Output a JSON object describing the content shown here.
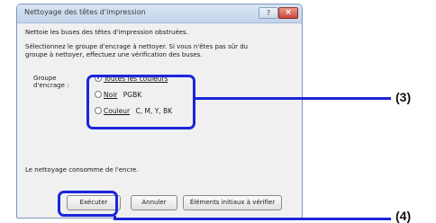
{
  "dialog": {
    "title": "Nettoyage des têtes d'impression",
    "help_symbol": "?",
    "close_symbol": "×",
    "intro": "Nettoie les buses des têtes d'impression obstruées.",
    "instruction_line1": "Sélectionnez le groupe d'encrage à nettoyer. Si vous n'êtes pas sûr du",
    "instruction_line2": "groupe à nettoyer, effectuez une vérification des buses.",
    "group_label_line1": "Groupe",
    "group_label_line2": "d'encrage :",
    "options": [
      {
        "label": "Toutes les couleurs",
        "checked": true
      },
      {
        "label": "Noir",
        "detail": "PGBK",
        "checked": false
      },
      {
        "label": "Couleur",
        "detail": "C, M, Y, BK",
        "checked": false
      }
    ],
    "note": "Le nettoyage consomme de l'encre.",
    "buttons": {
      "run": "Exécuter",
      "cancel": "Annuler",
      "items": "Éléments initiaux à vérifier"
    }
  },
  "callouts": {
    "options": "(3)",
    "execute": "(4)"
  },
  "colors": {
    "highlight": "#1c25d9",
    "dialog_bg": "#f0f0f0"
  }
}
